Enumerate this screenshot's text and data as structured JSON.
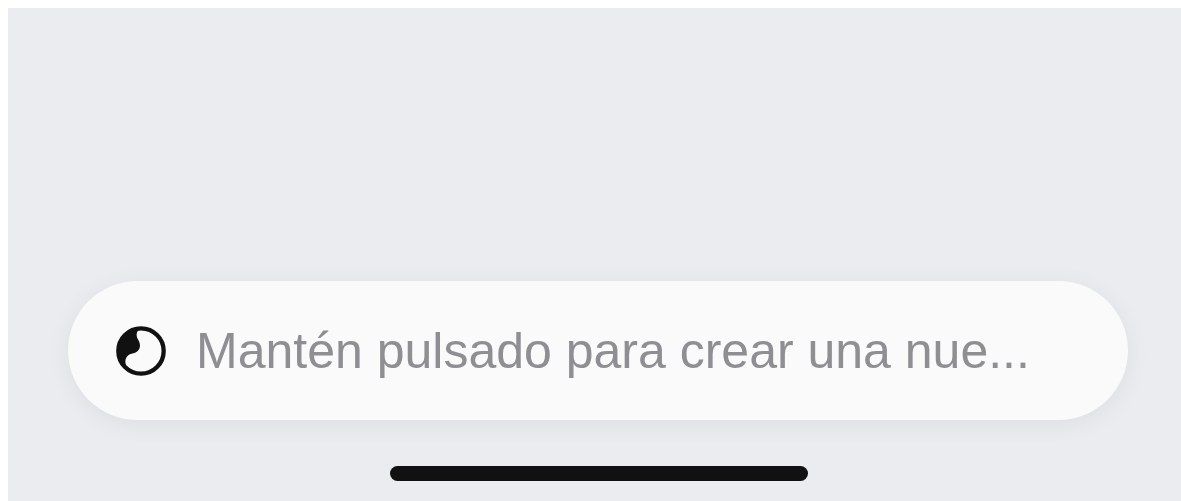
{
  "prompt_bar": {
    "placeholder": "Mantén pulsado para crear una nue..."
  },
  "home_indicator": true
}
